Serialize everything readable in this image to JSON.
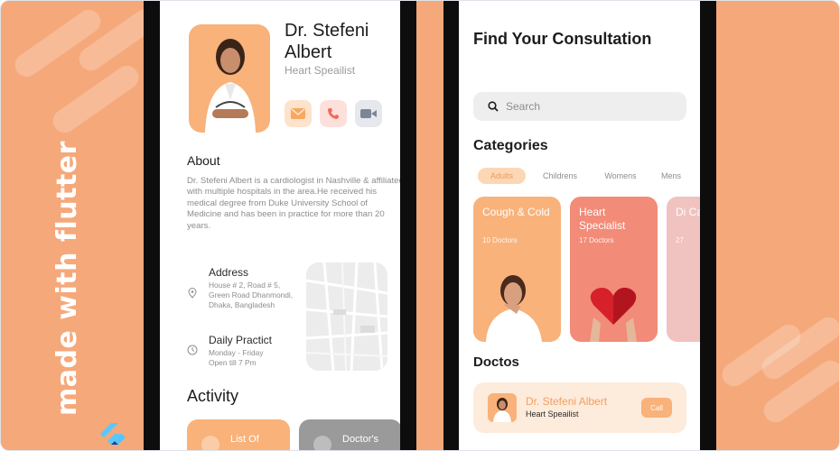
{
  "branding": {
    "text": "made with flutter",
    "logo": "flutter-logo"
  },
  "colors": {
    "background": "#f5a87a",
    "accent": "#f8b27a",
    "card_red": "#f28b78",
    "card_pink": "#f0c2c0",
    "text_dark": "#1d1d1d",
    "text_muted": "#8d8d8d"
  },
  "doctor_profile": {
    "name": "Dr. Stefeni Albert",
    "specialty": "Heart Speailist",
    "contact_buttons": [
      {
        "icon": "mail-icon"
      },
      {
        "icon": "phone-icon"
      },
      {
        "icon": "video-icon"
      }
    ],
    "about_heading": "About",
    "about_text": "Dr. Stefeni Albert is a cardiologist in Nashville & affiliated with multiple hospitals in the  area.He received his medical degree from Duke University School of Medicine and has been in practice for more than 20 years.",
    "address": {
      "title": "Address",
      "text": "House # 2, Road # 5, Green Road Dhanmondi, Dhaka, Bangladesh"
    },
    "hours": {
      "title": "Daily Practict",
      "text": "Monday - Friday Open till 7 Pm"
    },
    "activity_heading": "Activity",
    "activity_cards": [
      {
        "label": "List Of"
      },
      {
        "label": "Doctor's"
      }
    ]
  },
  "consultation": {
    "title": "Find Your Consultation",
    "search_placeholder": "Search",
    "categories_heading": "Categories",
    "chips": [
      {
        "label": "Adults",
        "selected": true
      },
      {
        "label": "Childrens",
        "selected": false
      },
      {
        "label": "Womens",
        "selected": false
      },
      {
        "label": "Mens",
        "selected": false
      }
    ],
    "category_cards": [
      {
        "title": "Cough & Cold",
        "count": "10 Doctors"
      },
      {
        "title": "Heart Specialist",
        "count": "17 Doctors"
      },
      {
        "title": "Di Ca",
        "count": "27"
      }
    ],
    "doctos_heading": "Doctos",
    "doctor_row": {
      "name": "Dr. Stefeni Albert",
      "specialty": "Heart Speailist",
      "call_label": "Call"
    }
  }
}
